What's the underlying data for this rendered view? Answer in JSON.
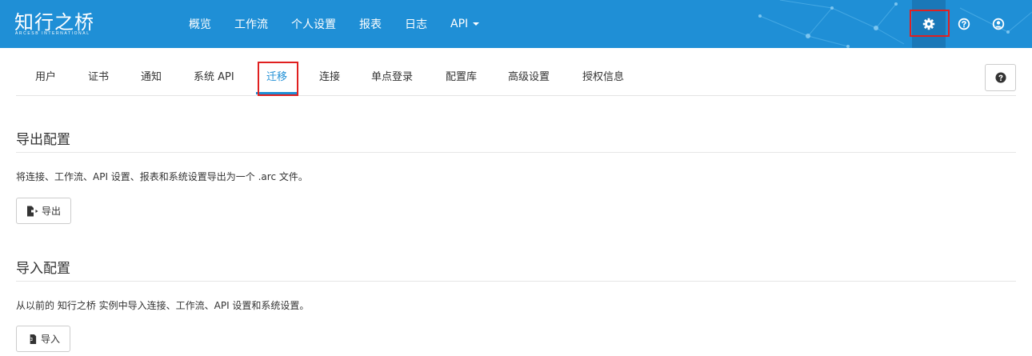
{
  "brand": {
    "name": "知行之桥",
    "subtitle": "ARCESB INTERNATIONAL"
  },
  "topnav": {
    "items": [
      "概览",
      "工作流",
      "个人设置",
      "报表",
      "日志",
      "API"
    ],
    "icons": [
      "gear-icon",
      "question-circle-icon",
      "user-circle-icon"
    ]
  },
  "tabs": {
    "items": [
      "用户",
      "证书",
      "通知",
      "系统 API",
      "迁移",
      "连接",
      "单点登录",
      "配置库",
      "高级设置",
      "授权信息"
    ],
    "active": "迁移"
  },
  "export_section": {
    "title": "导出配置",
    "description": "将连接、工作流、API 设置、报表和系统设置导出为一个 .arc 文件。",
    "button_label": "导出"
  },
  "import_section": {
    "title": "导入配置",
    "description": "从以前的 知行之桥 实例中导入连接、工作流、API 设置和系统设置。",
    "button_label": "导入"
  },
  "colors": {
    "header_bg": "#1f8fd6",
    "accent": "#1f8fd6",
    "highlight": "#e02020"
  }
}
